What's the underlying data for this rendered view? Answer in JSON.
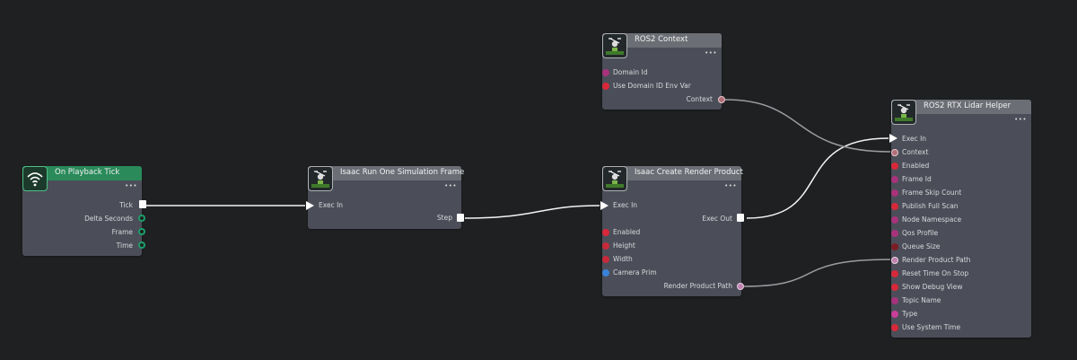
{
  "nodes": {
    "playback": {
      "title": "On Playback Tick",
      "outputs": [
        "Tick",
        "Delta Seconds",
        "Frame",
        "Time"
      ]
    },
    "sim_frame": {
      "title": "Isaac Run One Simulation Frame",
      "input": "Exec In",
      "output": "Step"
    },
    "render_product": {
      "title": "Isaac Create Render Product",
      "input": "Exec In",
      "output_exec": "Exec Out",
      "inputs": [
        "Enabled",
        "Height",
        "Width",
        "Camera Prim"
      ],
      "output": "Render Product Path"
    },
    "ros2_context": {
      "title": "ROS2 Context",
      "inputs": [
        "Domain Id",
        "Use Domain ID Env Var"
      ],
      "output": "Context"
    },
    "lidar_helper": {
      "title": "ROS2 RTX Lidar Helper",
      "inputs": [
        "Exec In",
        "Context",
        "Enabled",
        "Frame Id",
        "Frame Skip Count",
        "Publish Full Scan",
        "Node Namespace",
        "Qos Profile",
        "Queue Size",
        "Render Product Path",
        "Reset Time On Stop",
        "Show Debug View",
        "Topic Name",
        "Type",
        "Use System Time"
      ]
    }
  },
  "icons": {
    "graph_node": "graph-node-icon",
    "wifi": "wifi-icon",
    "more": "more-dots-icon"
  },
  "colors": {
    "background": "#1f2022",
    "node_body": "#4b4e58",
    "header": "#6b6e75",
    "header_event": "#2a8a5a",
    "wire": "#f2f2f2",
    "pin_bool": "#d8283a",
    "pin_int": "#a8327c",
    "pin_string": "#c83e9a",
    "pin_path": "#c080b0",
    "pin_target": "#3a82d8",
    "pin_context": "#b06e78",
    "pin_double": "#1b9e6a"
  }
}
